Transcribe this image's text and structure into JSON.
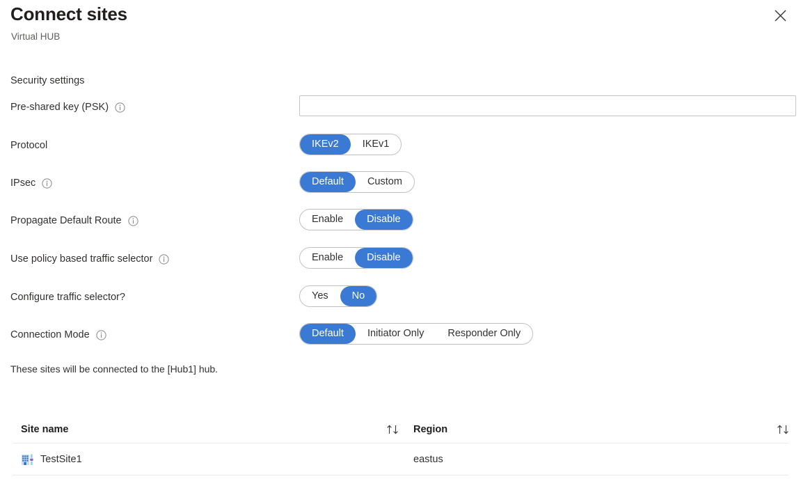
{
  "header": {
    "title": "Connect sites",
    "subtitle": "Virtual HUB",
    "close_icon": "close-icon"
  },
  "form": {
    "section_title": "Security settings",
    "rows": [
      {
        "label": "Pre-shared key (PSK)",
        "has_info": true,
        "type": "text",
        "value": "",
        "placeholder": ""
      },
      {
        "label": "Protocol",
        "has_info": false,
        "type": "toggle",
        "options": [
          "IKEv2",
          "IKEv1"
        ],
        "selected": "IKEv2"
      },
      {
        "label": "IPsec",
        "has_info": true,
        "type": "toggle",
        "options": [
          "Default",
          "Custom"
        ],
        "selected": "Default"
      },
      {
        "label": "Propagate Default Route",
        "has_info": true,
        "type": "toggle",
        "options": [
          "Enable",
          "Disable"
        ],
        "selected": "Disable"
      },
      {
        "label": "Use policy based traffic selector",
        "has_info": true,
        "type": "toggle",
        "options": [
          "Enable",
          "Disable"
        ],
        "selected": "Disable"
      },
      {
        "label": "Configure traffic selector?",
        "has_info": false,
        "type": "toggle",
        "options": [
          "Yes",
          "No"
        ],
        "selected": "No"
      },
      {
        "label": "Connection Mode",
        "has_info": true,
        "type": "toggle",
        "options": [
          "Default",
          "Initiator Only",
          "Responder Only"
        ],
        "selected": "Default"
      }
    ]
  },
  "table": {
    "note": "These sites will be connected to the [Hub1] hub.",
    "columns": [
      "Site name",
      "Region"
    ],
    "sort_icon": "sort-ascending-descending-icon",
    "rows": [
      {
        "site_name": "TestSite1",
        "region": "eastus",
        "icon": "branch-site-icon"
      }
    ]
  },
  "colors": {
    "accent_blue": "#3a7ad4",
    "text_primary": "#323130",
    "text_secondary": "#605e5c",
    "border": "#c8c6c4",
    "divider": "#edebe9"
  }
}
